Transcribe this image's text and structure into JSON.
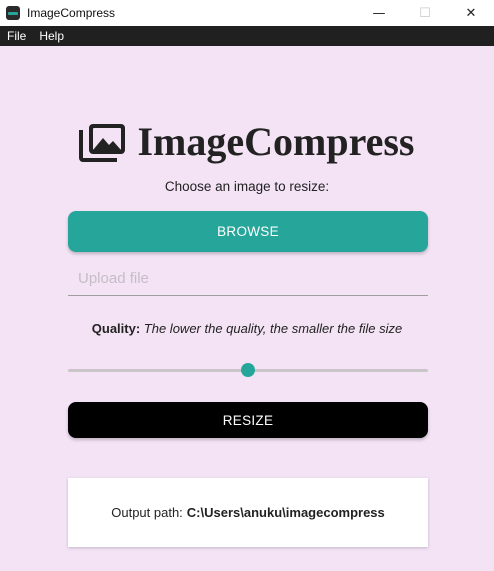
{
  "window": {
    "title": "ImageCompress",
    "controls": {
      "minimize": "—",
      "maximize": "☐",
      "close": "✕"
    }
  },
  "menu": {
    "items": [
      "File",
      "Help"
    ]
  },
  "header": {
    "logo_icon": "photo-library-icon",
    "title": "ImageCompress"
  },
  "main": {
    "subtitle": "Choose an image to resize:",
    "browse_label": "BROWSE",
    "upload_placeholder": "Upload file",
    "quality_label": "Quality:",
    "quality_desc": "The lower the quality, the smaller the file size",
    "quality_value_fraction": 0.5,
    "resize_label": "RESIZE",
    "output_label": "Output path:",
    "output_path": "C:\\Users\\anuku\\imagecompress"
  },
  "colors": {
    "background": "#f3e3f5",
    "accent": "#26a69a",
    "resize_button": "#000000",
    "menubar": "#202020"
  }
}
